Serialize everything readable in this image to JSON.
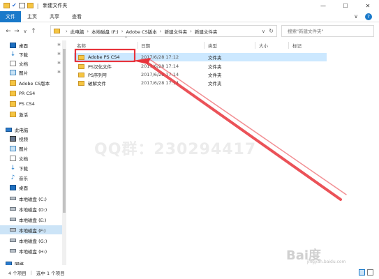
{
  "window": {
    "title": "新建文件夹",
    "controls": {
      "minimize": "—",
      "maximize": "☐",
      "close": "✕"
    }
  },
  "ribbon": {
    "tabs": [
      {
        "label": "文件",
        "active": true
      },
      {
        "label": "主页",
        "active": false
      },
      {
        "label": "共享",
        "active": false
      },
      {
        "label": "查看",
        "active": false
      }
    ],
    "expand_glyph": "∨",
    "help_glyph": "?"
  },
  "nav": {
    "back": "←",
    "forward": "→",
    "recent": "∨",
    "up": "↑"
  },
  "address": {
    "crumbs": [
      "此电脑",
      "本地磁盘 (F:)",
      "Adobe CS版本",
      "新建文件夹",
      "新建文件夹"
    ],
    "separator": "›",
    "dropdown_glyph": "∨",
    "refresh_glyph": "↻"
  },
  "search": {
    "placeholder": "搜索\"新建文件夹\""
  },
  "sidebar": {
    "items": [
      {
        "label": "桌面",
        "icon": "desktop-icon",
        "pinned": true
      },
      {
        "label": "下载",
        "icon": "download-icon",
        "pinned": true
      },
      {
        "label": "文档",
        "icon": "documents-icon",
        "pinned": true
      },
      {
        "label": "图片",
        "icon": "pictures-icon",
        "pinned": true
      },
      {
        "label": "Adobe CS版本",
        "icon": "folder-icon",
        "pinned": false
      },
      {
        "label": "PR CS4",
        "icon": "folder-icon",
        "pinned": false
      },
      {
        "label": "PS  CS4",
        "icon": "folder-icon",
        "pinned": false
      },
      {
        "label": "激活",
        "icon": "folder-icon",
        "pinned": false
      },
      {
        "label": "此电脑",
        "icon": "computer-icon",
        "pinned": false
      },
      {
        "label": "视频",
        "icon": "video-icon",
        "pinned": false
      },
      {
        "label": "图片",
        "icon": "pictures-icon",
        "pinned": false
      },
      {
        "label": "文档",
        "icon": "documents-icon",
        "pinned": false
      },
      {
        "label": "下载",
        "icon": "download-icon",
        "pinned": false
      },
      {
        "label": "音乐",
        "icon": "music-icon",
        "pinned": false
      },
      {
        "label": "桌面",
        "icon": "desktop-icon",
        "pinned": false
      },
      {
        "label": "本地磁盘 (C:)",
        "icon": "drive-icon",
        "pinned": false
      },
      {
        "label": "本地磁盘 (D:)",
        "icon": "drive-icon",
        "pinned": false
      },
      {
        "label": "本地磁盘 (E:)",
        "icon": "drive-icon",
        "pinned": false
      },
      {
        "label": "本地磁盘 (F:)",
        "icon": "drive-icon",
        "pinned": false,
        "selected": true
      },
      {
        "label": "本地磁盘 (G:)",
        "icon": "drive-icon",
        "pinned": false
      },
      {
        "label": "本地磁盘 (H:)",
        "icon": "drive-icon",
        "pinned": false
      },
      {
        "label": "网络",
        "icon": "network-icon",
        "pinned": false
      }
    ],
    "pin_glyph": "✱"
  },
  "columns": {
    "name": "名称",
    "date": "日期",
    "type": "类型",
    "size": "大小",
    "tags": "标记",
    "sort_glyph": "^"
  },
  "files": [
    {
      "name": "Adobe PS CS4",
      "date": "2017/6/28 17:12",
      "type": "文件夹",
      "selected": true
    },
    {
      "name": "PS汉化文件",
      "date": "2017/6/28 17:14",
      "type": "文件夹",
      "selected": false
    },
    {
      "name": "PS序列号",
      "date": "2017/6/28 17:14",
      "type": "文件夹",
      "selected": false
    },
    {
      "name": "破解文件",
      "date": "2017/6/28 17:14",
      "type": "文件夹",
      "selected": false
    }
  ],
  "status": {
    "count": "4 个项目",
    "selection": "选中 1 个项目"
  },
  "overlay": {
    "watermark": "QQ群：230294417",
    "baidu": "Bai度",
    "baidu_sub": "jingyan.baidu.com"
  },
  "colors": {
    "accent": "#1979ca",
    "selection": "#cce8ff",
    "annotation": "#e8343c",
    "folder": "#f5c542"
  }
}
